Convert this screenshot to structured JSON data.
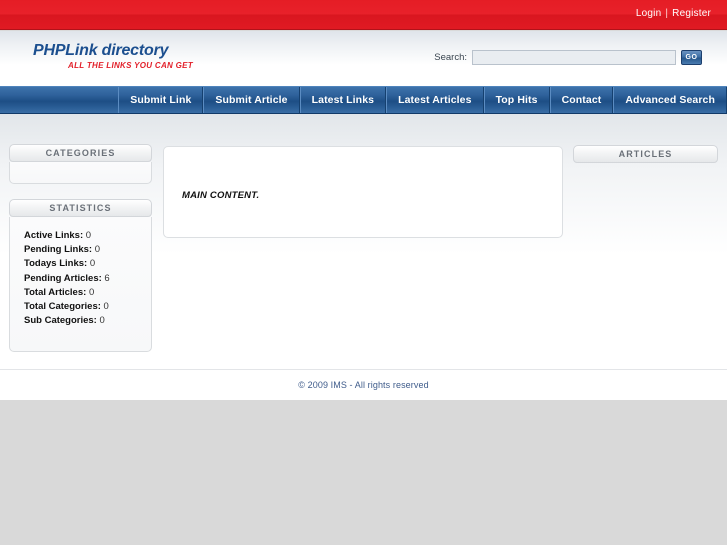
{
  "topbar": {
    "login_label": "Login",
    "separator": "|",
    "register_label": "Register",
    "background_color": "#e51d25"
  },
  "header": {
    "logo_main": "PHPLink directory",
    "logo_tagline": "ALL THE LINKS YOU CAN GET",
    "logo_color": "#1c4f8f",
    "tagline_color": "#e2202a",
    "search": {
      "label": "Search:",
      "value": "",
      "placeholder": "",
      "button_label": "GO"
    }
  },
  "nav": {
    "items": [
      {
        "label": "Submit Link"
      },
      {
        "label": "Submit Article"
      },
      {
        "label": "Latest Links"
      },
      {
        "label": "Latest Articles"
      },
      {
        "label": "Top Hits"
      },
      {
        "label": "Contact"
      },
      {
        "label": "Advanced Search"
      }
    ],
    "background_color": "#1d4e85"
  },
  "sidebar_left": {
    "categories": {
      "title": "CATEGORIES",
      "items": []
    },
    "statistics": {
      "title": "STATISTICS",
      "rows": [
        {
          "label": "Active Links:",
          "value": "0"
        },
        {
          "label": "Pending Links:",
          "value": "0"
        },
        {
          "label": "Todays Links:",
          "value": "0"
        },
        {
          "label": "Pending Articles:",
          "value": "6"
        },
        {
          "label": "Total Articles:",
          "value": "0"
        },
        {
          "label": "Total Categories:",
          "value": "0"
        },
        {
          "label": "Sub Categories:",
          "value": "0"
        }
      ]
    }
  },
  "main": {
    "content_text": "MAIN CONTENT."
  },
  "sidebar_right": {
    "articles": {
      "title": "ARTICLES",
      "items": []
    }
  },
  "footer": {
    "copyright": "© 2009 IMS - All rights reserved",
    "text_color": "#3f5c8b"
  }
}
